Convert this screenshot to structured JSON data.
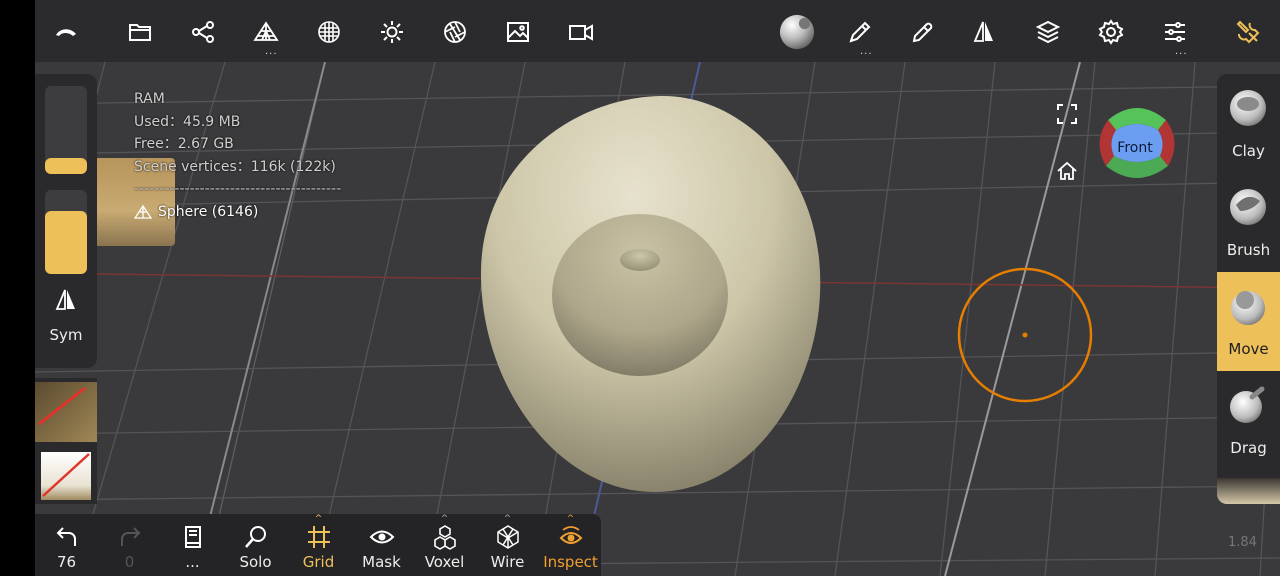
{
  "stats": {
    "title": "RAM",
    "used": "Used：45.9 MB",
    "free": "Free：2.67 GB",
    "vertices": "Scene vertices：116k (122k)",
    "separator": "-----------------------------------------",
    "mesh": "Sphere (6146)"
  },
  "left_panel": {
    "sym_label": "Sym",
    "radius_level": 0.1,
    "intensity_level": 0.75
  },
  "gizmo": {
    "label": "Front"
  },
  "tools": [
    {
      "label": "Clay",
      "active": false
    },
    {
      "label": "Brush",
      "active": false
    },
    {
      "label": "Move",
      "active": true
    },
    {
      "label": "Drag",
      "active": false
    }
  ],
  "bottom": {
    "undo_count": "76",
    "redo_count": "0",
    "more": "...",
    "solo": "Solo",
    "grid": "Grid",
    "mask": "Mask",
    "voxel": "Voxel",
    "wire": "Wire",
    "inspect": "Inspect"
  },
  "toolbar_more": "...",
  "version": "1.84",
  "colors": {
    "accent": "#eec05a",
    "orange": "#e67e00",
    "inspect": "#f0a030"
  }
}
